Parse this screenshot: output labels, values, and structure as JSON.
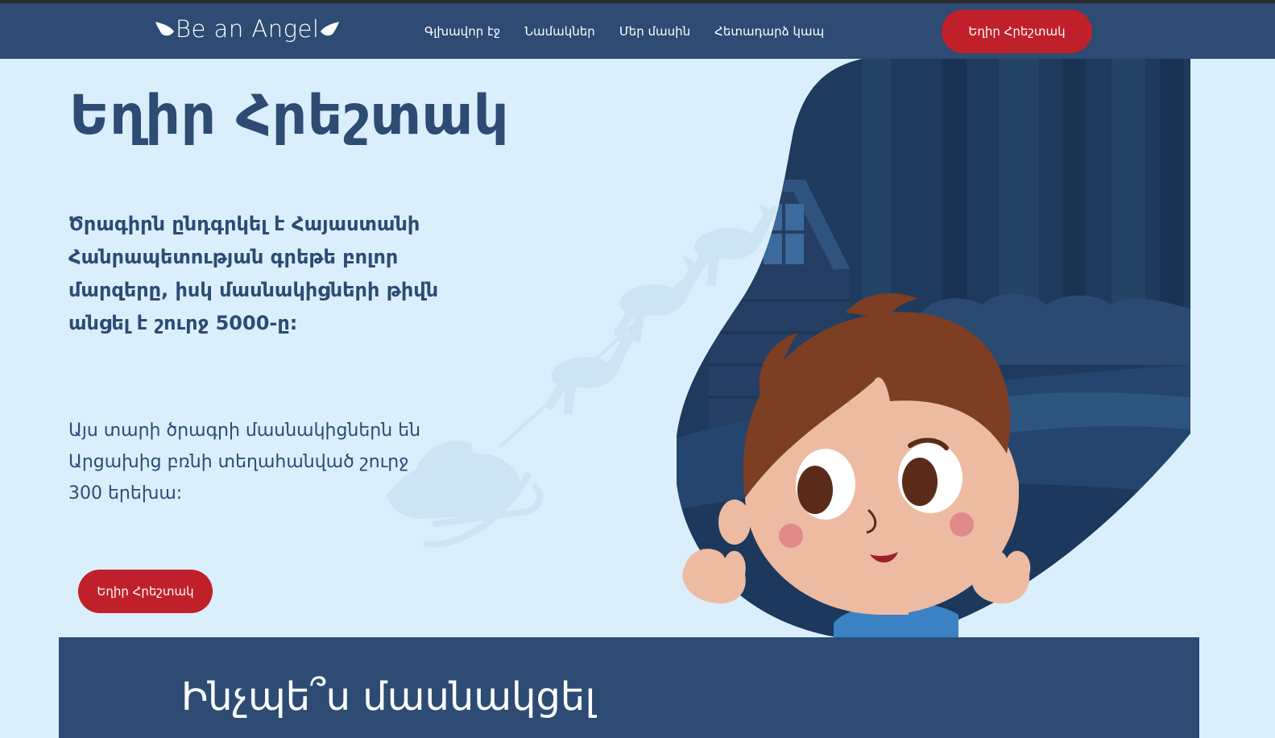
{
  "brand": {
    "logo_text": "Be an Angel"
  },
  "nav": {
    "links": [
      "Գլխավոր էջ",
      "Նամակներ",
      "Մեր մասին",
      "Հետադարձ կապ"
    ],
    "cta_label": "Եղիր Հրեշտակ"
  },
  "hero": {
    "title": "Եղիր Հրեշտակ",
    "lead": "Ծրագիրն ընդգրկել է Հայաստանի Հանրապետության գրեթե բոլոր մարզերը, իսկ մասնակիցների թիվն անցել է շուրջ 5000-ը:",
    "subtext": "Այս տարի ծրագրի մասնակիցներն են Արցախից բռնի տեղահանված շուրջ 300 երեխա:",
    "cta_label": "Եղիր Հրեշտակ"
  },
  "how_section": {
    "title": "Ինչպե՞ս մասնակցել"
  },
  "colors": {
    "nav_bg": "#2d4b73",
    "page_bg": "#daeefc",
    "accent_red": "#c0202a",
    "heading_text": "#2d4b73"
  }
}
